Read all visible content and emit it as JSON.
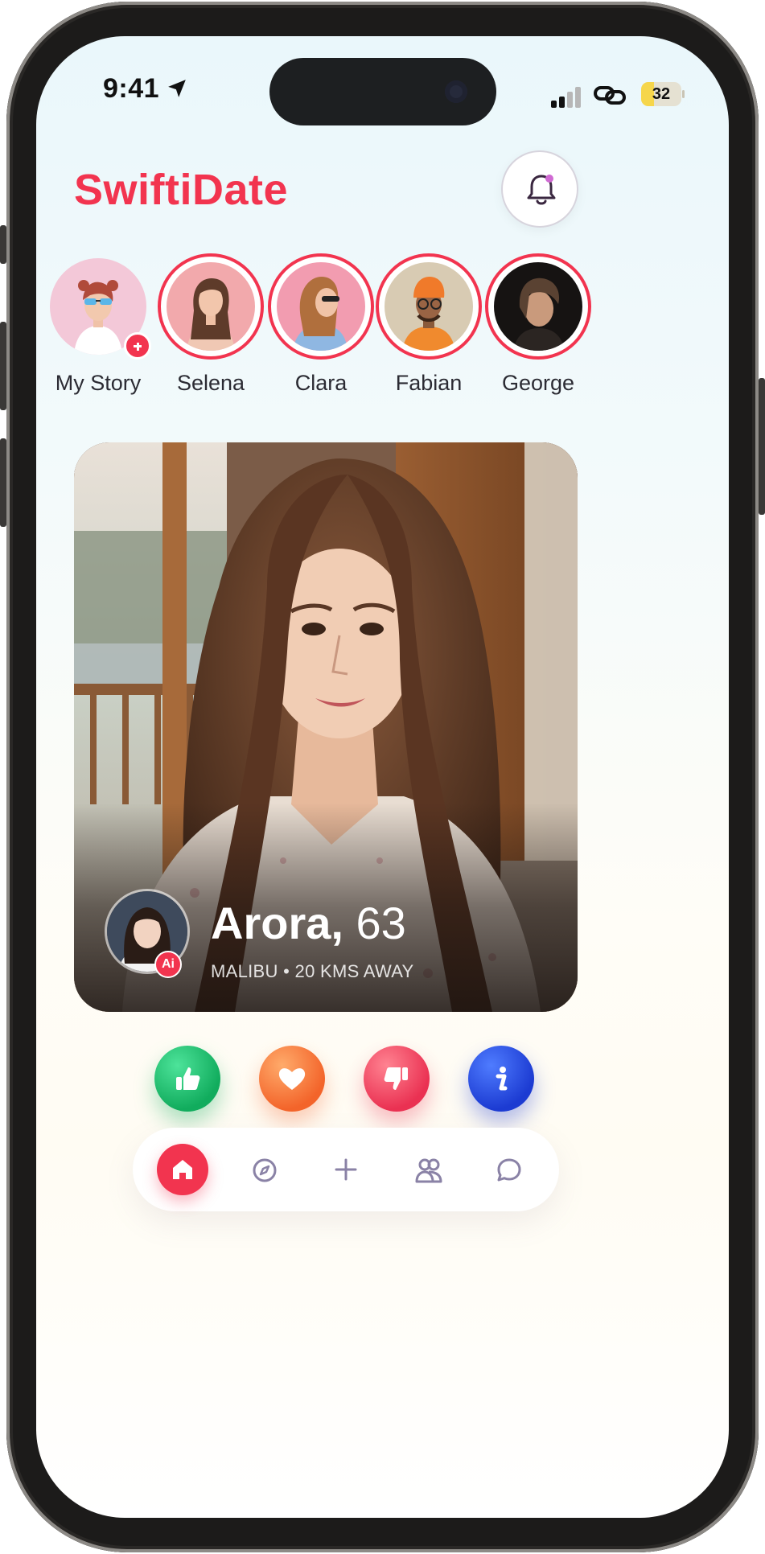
{
  "status_bar": {
    "time": "9:41",
    "battery": "32"
  },
  "header": {
    "title": "SwiftiDate"
  },
  "stories": [
    {
      "name": "My Story"
    },
    {
      "name": "Selena"
    },
    {
      "name": "Clara"
    },
    {
      "name": "Fabian"
    },
    {
      "name": "George"
    }
  ],
  "card": {
    "name": "Arora,",
    "age": "63",
    "location": "MALIBU • 20 KMS AWAY",
    "badge": "Ai"
  },
  "actions": [
    "like",
    "favorite",
    "dislike",
    "info"
  ],
  "nav": [
    "home",
    "explore",
    "add",
    "matches",
    "chat"
  ],
  "colors": {
    "brand": "#f2344f",
    "like": "#11ac5d",
    "favorite": "#f3642a",
    "dislike": "#ea3152",
    "info": "#1c3bd2",
    "nav_icon": "#8a82a6"
  }
}
